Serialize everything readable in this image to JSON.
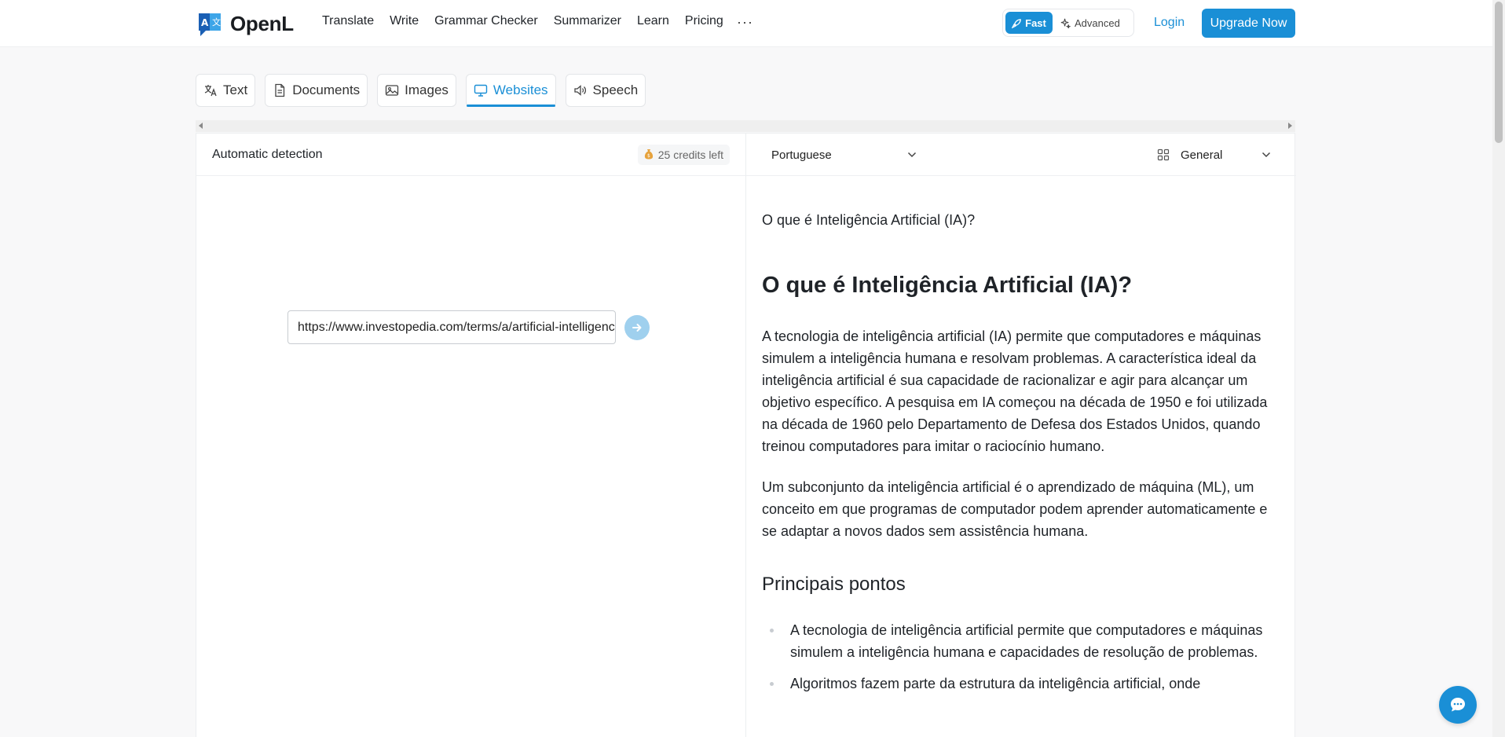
{
  "brand": {
    "name": "OpenL",
    "brand_color": "#1a8fd6"
  },
  "nav": {
    "items": [
      "Translate",
      "Write",
      "Grammar Checker",
      "Summarizer",
      "Learn",
      "Pricing"
    ],
    "more": "···"
  },
  "mode": {
    "fast": "Fast",
    "advanced": "Advanced"
  },
  "auth": {
    "login": "Login",
    "upgrade": "Upgrade Now"
  },
  "tabs": [
    {
      "label": "Text",
      "icon": "translate-icon"
    },
    {
      "label": "Documents",
      "icon": "document-icon"
    },
    {
      "label": "Images",
      "icon": "image-icon"
    },
    {
      "label": "Websites",
      "icon": "monitor-icon",
      "active": true
    },
    {
      "label": "Speech",
      "icon": "speaker-icon"
    }
  ],
  "source": {
    "language": "Automatic detection",
    "credits": "25 credits left",
    "url_value": "https://www.investopedia.com/terms/a/artificial-intelligence-ai.asp"
  },
  "target": {
    "language": "Portuguese",
    "domain": "General"
  },
  "translation": {
    "doc_title": "O que é Inteligência Artificial (IA)?",
    "heading": "O que é Inteligência Artificial (IA)?",
    "paragraphs": [
      "A tecnologia de inteligência artificial (IA) permite que computadores e máquinas simulem a inteligência humana e resolvam problemas. A característica ideal da inteligência artificial é sua capacidade de racionalizar e agir para alcançar um objetivo específico. A pesquisa em IA começou na década de 1950 e foi utilizada na década de 1960 pelo Departamento de Defesa dos Estados Unidos, quando treinou computadores para imitar o raciocínio humano.",
      "Um subconjunto da inteligência artificial é o aprendizado de máquina (ML), um conceito em que programas de computador podem aprender automaticamente e se adaptar a novos dados sem assistência humana."
    ],
    "subheading": "Principais pontos",
    "bullets": [
      "A tecnologia de inteligência artificial permite que computadores e máquinas simulem a inteligência humana e capacidades de resolução de problemas.",
      "Algoritmos fazem parte da estrutura da inteligência artificial, onde"
    ]
  }
}
